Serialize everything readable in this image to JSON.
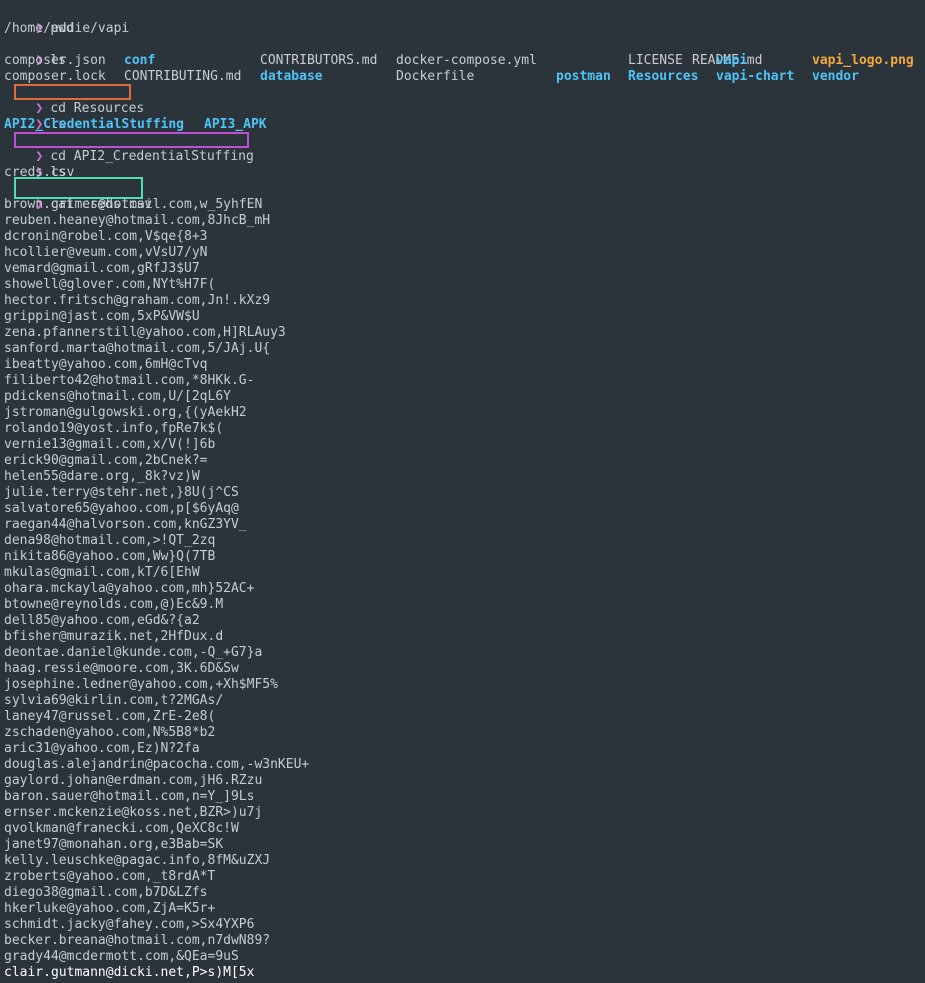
{
  "colors": {
    "background": "#2b333b",
    "text": "#c8ccd1",
    "prompt": "#d36fd8",
    "directory": "#4fc3f7",
    "image_file": "#f3a93b",
    "box_orange": "#e06c3c",
    "box_magenta": "#c04fd8",
    "box_teal": "#4fe0b0"
  },
  "prompt_symbol": "❯",
  "commands": {
    "pwd": "pwd",
    "pwd_output": "/home/eddie/vapi",
    "ls1": "ls",
    "cd_resources": "cd Resources",
    "ls2": "ls",
    "cd_api2": "cd API2_CredentialStuffing",
    "ls3": "ls",
    "ls3_output": "creds.csv",
    "cat": "cat creds.csv"
  },
  "ls1_output": {
    "row1": [
      "composer.json",
      "conf",
      "CONTRIBUTORS.md",
      "docker-compose.yml",
      "LICENSE",
      "README.md",
      "vapi",
      "vapi_logo.png"
    ],
    "row2": [
      "composer.lock",
      "CONTRIBUTING.md",
      "database",
      "Dockerfile",
      "postman",
      "Resources",
      "vapi-chart",
      "vendor"
    ]
  },
  "ls2_output": [
    "API2_CredentialStuffing",
    "API3_APK"
  ],
  "credentials": [
    "brown.grimes@hotmail.com,w_5yhfEN",
    "reuben.heaney@hotmail.com,8JhcB_mH",
    "dcronin@robel.com,V$qe{8+3",
    "hcollier@veum.com,vVsU7/yN",
    "vemard@gmail.com,gRfJ3$U7",
    "showell@glover.com,NYt%H7F(",
    "hector.fritsch@graham.com,Jn!.kXz9",
    "grippin@jast.com,5xP&VW$U",
    "zena.pfannerstill@yahoo.com,H]RLAuy3",
    "sanford.marta@hotmail.com,5/JAj.U{",
    "ibeatty@yahoo.com,6mH@cTvq",
    "filiberto42@hotmail.com,*8HKk.G-",
    "pdickens@hotmail.com,U/[2qL6Y",
    "jstroman@gulgowski.org,{(yAekH2",
    "rolando19@yost.info,fpRe7k$(",
    "vernie13@gmail.com,x/V(!]6b",
    "erick90@gmail.com,2bCnek?=",
    "helen55@dare.org,_8k?vz)W",
    "julie.terry@stehr.net,}8U(j^CS",
    "salvatore65@yahoo.com,p[$6yAq@",
    "raegan44@halvorson.com,knGZ3YV_",
    "dena98@hotmail.com,>!QT_2zq",
    "nikita86@yahoo.com,Ww}Q(7TB",
    "mkulas@gmail.com,kT/6[EhW",
    "ohara.mckayla@yahoo.com,mh}52AC+",
    "btowne@reynolds.com,@)Ec&9.M",
    "dell85@yahoo.com,eGd&?{a2",
    "bfisher@murazik.net,2HfDux.d",
    "deontae.daniel@kunde.com,-Q_+G7}a",
    "haag.ressie@moore.com,3K.6D&Sw",
    "josephine.ledner@yahoo.com,+Xh$MF5%",
    "sylvia69@kirlin.com,t?2MGAs/",
    "laney47@russel.com,ZrE-2e8(",
    "zschaden@yahoo.com,N%5B8*b2",
    "aric31@yahoo.com,Ez)N?2fa",
    "douglas.alejandrin@pacocha.com,-w3nKEU+",
    "gaylord.johan@erdman.com,jH6.RZzu",
    "baron.sauer@hotmail.com,n=Y_]9Ls",
    "ernser.mckenzie@koss.net,BZR>)u7j",
    "qvolkman@franecki.com,QeXC8c!W",
    "janet97@monahan.org,e3Bab=SK",
    "kelly.leuschke@pagac.info,8fM&uZXJ",
    "zroberts@yahoo.com,_t8rdA*T",
    "diego38@gmail.com,b7D&LZfs",
    "hkerluke@yahoo.com,ZjA=K5r+",
    "schmidt.jacky@fahey.com,>Sx4YXP6",
    "becker.breana@hotmail.com,n7dwN89?",
    "grady44@mcdermott.com,&QEa=9uS",
    "clair.gutmann@dicki.net,P>s)M[5x"
  ]
}
